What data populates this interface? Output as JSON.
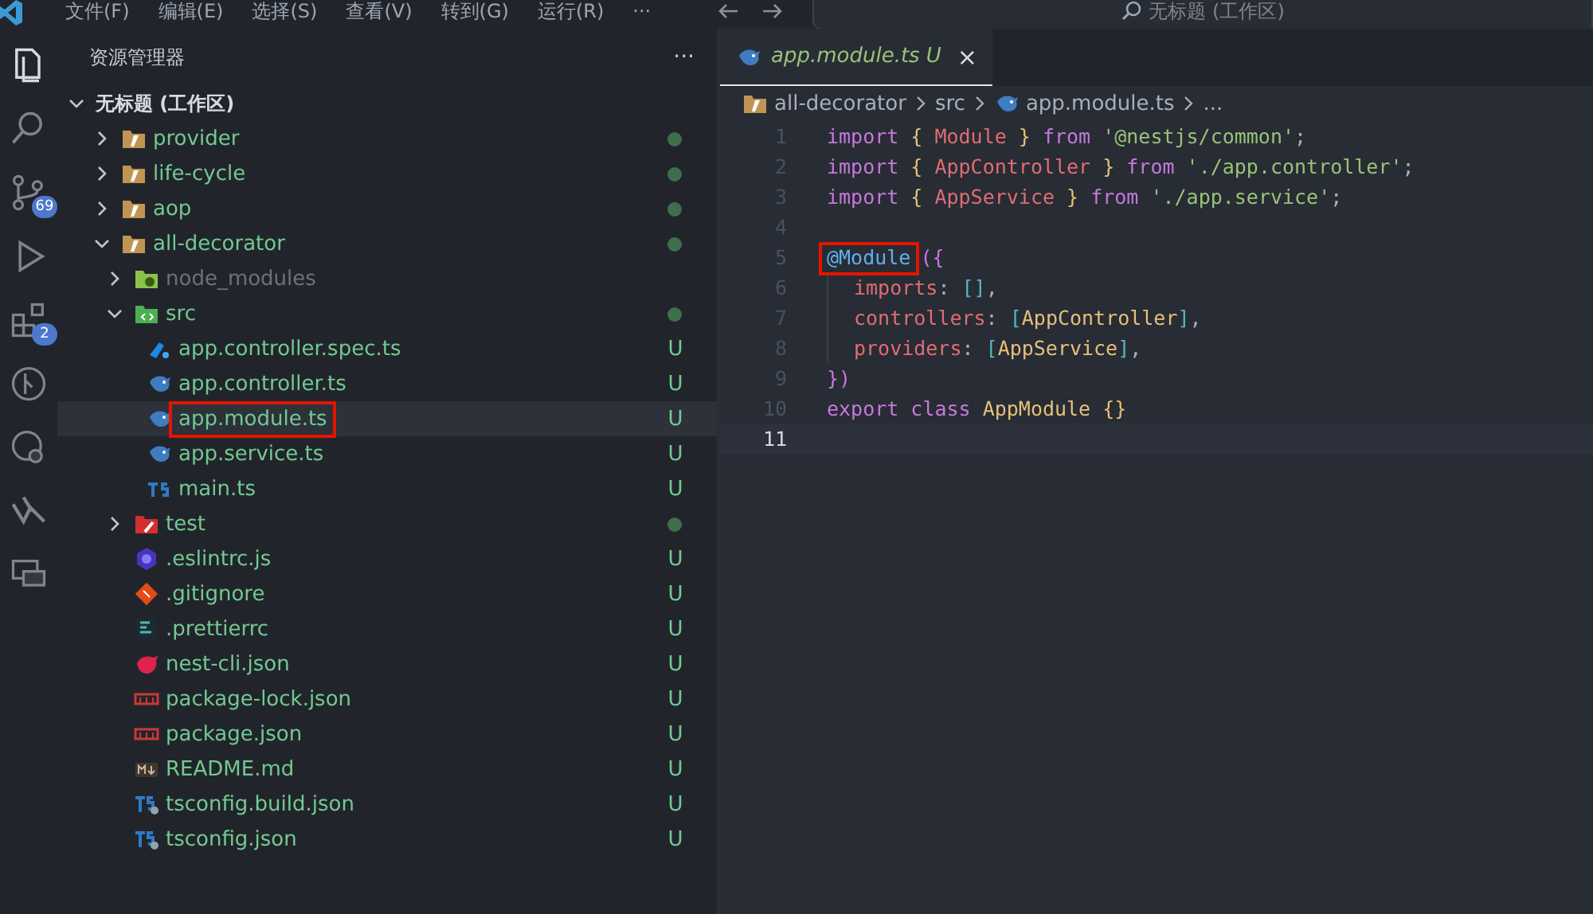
{
  "menu": [
    "文件(F)",
    "编辑(E)",
    "选择(S)",
    "查看(V)",
    "转到(G)",
    "运行(R)",
    "···"
  ],
  "command_center": {
    "label": "无标题 (工作区)"
  },
  "activity_bar": [
    {
      "kind": "files",
      "selected": true
    },
    {
      "kind": "search",
      "selected": false
    },
    {
      "kind": "source-control",
      "selected": false,
      "badge": "69"
    },
    {
      "kind": "run",
      "selected": false
    },
    {
      "kind": "extensions",
      "selected": false,
      "badge": "2"
    },
    {
      "kind": "branch",
      "selected": false
    },
    {
      "kind": "remote",
      "selected": false
    },
    {
      "kind": "share",
      "selected": false
    },
    {
      "kind": "comments",
      "selected": false
    }
  ],
  "explorer": {
    "title": "资源管理器",
    "more": "···",
    "workspace": {
      "label": "无标题 (工作区)",
      "expanded": true
    },
    "items": [
      {
        "label": "provider",
        "kind": "folder",
        "expanded": false,
        "modified": true,
        "selected": false,
        "highlighted": false
      },
      {
        "label": "life-cycle",
        "kind": "folder",
        "expanded": false,
        "modified": true,
        "selected": false,
        "highlighted": false
      },
      {
        "label": "aop",
        "kind": "folder",
        "expanded": false,
        "modified": true,
        "selected": false,
        "highlighted": false
      },
      {
        "label": "all-decorator",
        "kind": "folder",
        "expanded": true,
        "modified": true,
        "selected": false,
        "highlighted": false,
        "children": [
          {
            "label": "node_modules",
            "kind": "folder-node",
            "expanded": false,
            "modified": false,
            "dimmed": true,
            "selected": false,
            "highlighted": false
          },
          {
            "label": "src",
            "kind": "folder-src",
            "expanded": true,
            "modified": true,
            "selected": false,
            "highlighted": false,
            "children": [
              {
                "label": "app.controller.spec.ts",
                "kind": "ts-spec",
                "badge": "U",
                "modified": false,
                "selected": false,
                "highlighted": false
              },
              {
                "label": "app.controller.ts",
                "kind": "nest-ts",
                "badge": "U",
                "modified": false,
                "selected": false,
                "highlighted": false
              },
              {
                "label": "app.module.ts",
                "kind": "nest-ts",
                "badge": "U",
                "modified": false,
                "selected": true,
                "highlighted": true
              },
              {
                "label": "app.service.ts",
                "kind": "nest-ts",
                "badge": "U",
                "modified": false,
                "selected": false,
                "highlighted": false
              },
              {
                "label": "main.ts",
                "kind": "ts",
                "badge": "U",
                "modified": false,
                "selected": false,
                "highlighted": false
              }
            ]
          },
          {
            "label": "test",
            "kind": "folder-test",
            "expanded": false,
            "modified": true,
            "selected": false,
            "highlighted": false
          },
          {
            "label": ".eslintrc.js",
            "kind": "eslint",
            "badge": "U",
            "modified": false,
            "selected": false,
            "highlighted": false
          },
          {
            "label": ".gitignore",
            "kind": "git",
            "badge": "U",
            "modified": false,
            "selected": false,
            "highlighted": false
          },
          {
            "label": ".prettierrc",
            "kind": "prettier",
            "badge": "U",
            "modified": false,
            "selected": false,
            "highlighted": false
          },
          {
            "label": "nest-cli.json",
            "kind": "nest",
            "badge": "U",
            "modified": false,
            "selected": false,
            "highlighted": false
          },
          {
            "label": "package-lock.json",
            "kind": "npm",
            "badge": "U",
            "modified": false,
            "selected": false,
            "highlighted": false
          },
          {
            "label": "package.json",
            "kind": "npm",
            "badge": "U",
            "modified": false,
            "selected": false,
            "highlighted": false
          },
          {
            "label": "README.md",
            "kind": "markdown",
            "badge": "U",
            "modified": false,
            "selected": false,
            "highlighted": false
          },
          {
            "label": "tsconfig.build.json",
            "kind": "tsconfig",
            "badge": "U",
            "modified": false,
            "selected": false,
            "highlighted": false
          },
          {
            "label": "tsconfig.json",
            "kind": "tsconfig",
            "badge": "U",
            "modified": false,
            "selected": false,
            "highlighted": false
          }
        ]
      }
    ]
  },
  "tabs": [
    {
      "label": "app.module.ts",
      "badge": "U",
      "close": "×",
      "kind": "nest-ts",
      "selected": true
    }
  ],
  "breadcrumb": [
    {
      "label": "all-decorator",
      "kind": "folder"
    },
    {
      "label": "src"
    },
    {
      "label": "app.module.ts",
      "kind": "nest-ts"
    },
    {
      "label": "..."
    }
  ],
  "code": [
    {
      "number": "1",
      "current": false,
      "tokens": [
        {
          "text": "import",
          "kind": "keyword"
        },
        {
          "text": " { ",
          "kind": "brace1"
        },
        {
          "text": "Module",
          "kind": "variable"
        },
        {
          "text": " } ",
          "kind": "brace1"
        },
        {
          "text": "from",
          "kind": "keyword"
        },
        {
          "text": " '@nestjs/common'",
          "kind": "string"
        },
        {
          "text": ";",
          "kind": "punct"
        }
      ]
    },
    {
      "number": "2",
      "current": false,
      "tokens": [
        {
          "text": "import",
          "kind": "keyword"
        },
        {
          "text": " { ",
          "kind": "brace1"
        },
        {
          "text": "AppController",
          "kind": "variable"
        },
        {
          "text": " } ",
          "kind": "brace1"
        },
        {
          "text": "from",
          "kind": "keyword"
        },
        {
          "text": " './app.controller'",
          "kind": "string"
        },
        {
          "text": ";",
          "kind": "punct"
        }
      ]
    },
    {
      "number": "3",
      "current": false,
      "tokens": [
        {
          "text": "import",
          "kind": "keyword"
        },
        {
          "text": " { ",
          "kind": "brace1"
        },
        {
          "text": "AppService",
          "kind": "variable"
        },
        {
          "text": " } ",
          "kind": "brace1"
        },
        {
          "text": "from",
          "kind": "keyword"
        },
        {
          "text": " './app.service'",
          "kind": "string"
        },
        {
          "text": ";",
          "kind": "punct"
        }
      ]
    },
    {
      "number": "4",
      "current": false
    },
    {
      "number": "5",
      "current": false,
      "tokens": [
        {
          "text": "@Module",
          "kind": "decorator",
          "highlighted": true
        },
        {
          "text": "({",
          "kind": "brace2"
        }
      ]
    },
    {
      "number": "6",
      "current": false,
      "indented": true,
      "tokens": [
        {
          "text": "imports",
          "kind": "property"
        },
        {
          "text": ": ",
          "kind": "punct"
        },
        {
          "text": "[]",
          "kind": "brace3"
        },
        {
          "text": ",",
          "kind": "punct"
        }
      ]
    },
    {
      "number": "7",
      "current": false,
      "indented": true,
      "tokens": [
        {
          "text": "controllers",
          "kind": "property"
        },
        {
          "text": ": ",
          "kind": "punct"
        },
        {
          "text": "[",
          "kind": "brace3"
        },
        {
          "text": "AppController",
          "kind": "class"
        },
        {
          "text": "]",
          "kind": "brace3"
        },
        {
          "text": ",",
          "kind": "punct"
        }
      ]
    },
    {
      "number": "8",
      "current": false,
      "indented": true,
      "tokens": [
        {
          "text": "providers",
          "kind": "property"
        },
        {
          "text": ": ",
          "kind": "punct"
        },
        {
          "text": "[",
          "kind": "brace3"
        },
        {
          "text": "AppService",
          "kind": "class"
        },
        {
          "text": "]",
          "kind": "brace3"
        },
        {
          "text": ",",
          "kind": "punct"
        }
      ]
    },
    {
      "number": "9",
      "current": false,
      "tokens": [
        {
          "text": "})",
          "kind": "brace2"
        }
      ]
    },
    {
      "number": "10",
      "current": false,
      "tokens": [
        {
          "text": "export class",
          "kind": "keyword"
        },
        {
          "text": " AppModule ",
          "kind": "class"
        },
        {
          "text": "{}",
          "kind": "brace1"
        }
      ]
    },
    {
      "number": "11",
      "current": true
    }
  ]
}
